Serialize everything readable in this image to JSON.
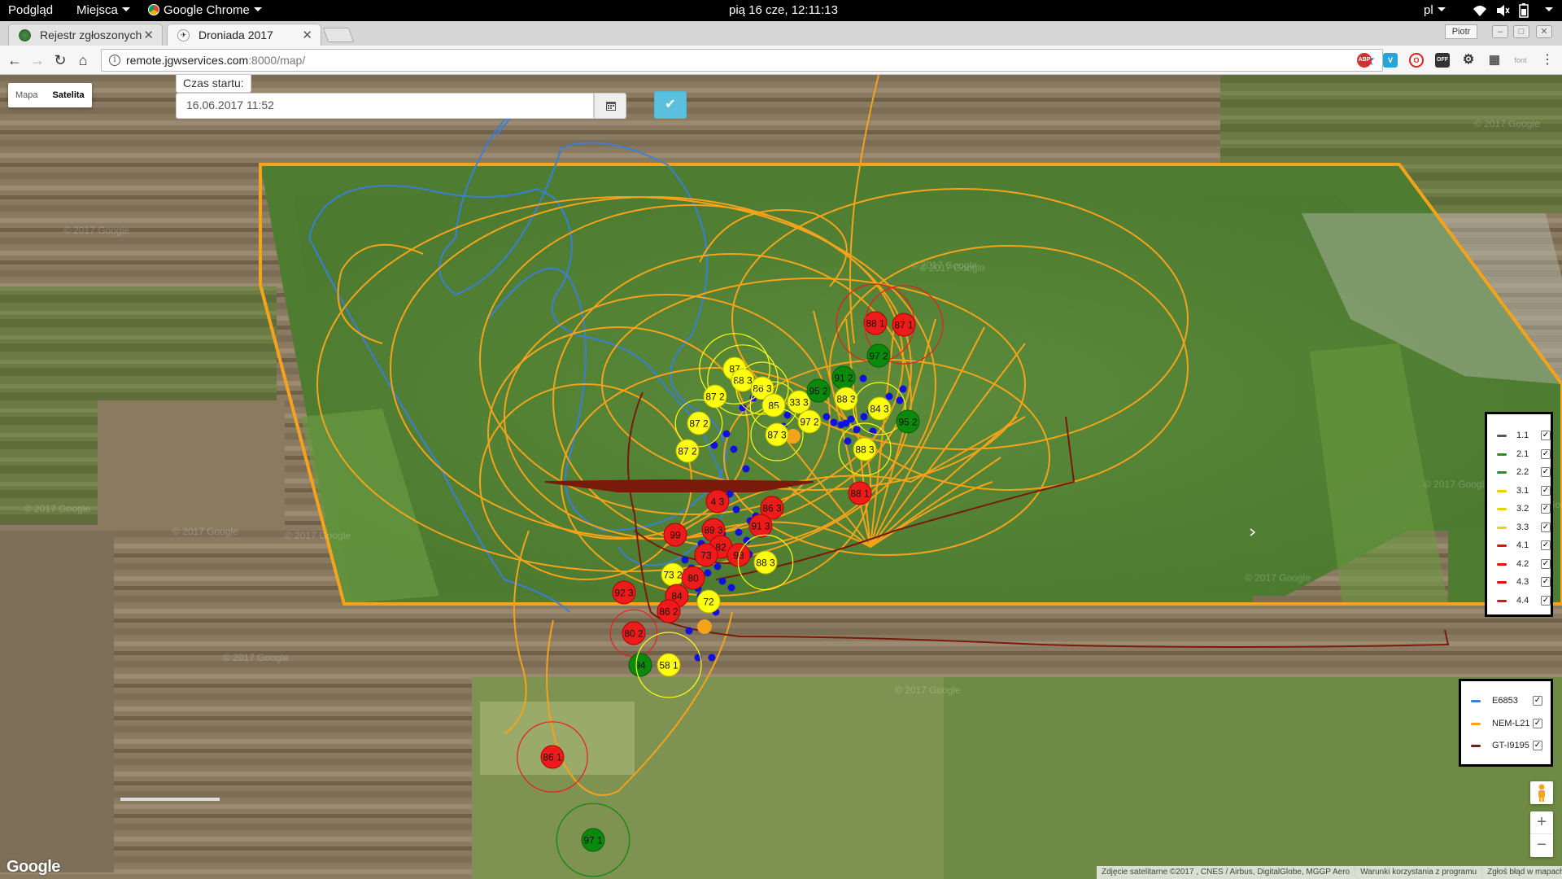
{
  "topbar": {
    "activities": "Podgląd",
    "places": "Miejsca",
    "app": "Google Chrome",
    "clock": "pią 16 cze, 12:11:13",
    "lang": "pl"
  },
  "tabs": [
    {
      "title": "Rejestr zgłoszonych",
      "active": false
    },
    {
      "title": "Droniada 2017",
      "active": true
    }
  ],
  "window": {
    "profile": "Piotr"
  },
  "toolbar": {
    "url_host": "remote.jgwservices.com",
    "url_rest": ":8000/map/"
  },
  "extensions": [
    "ABP",
    "V",
    "O",
    "OFF",
    "⚙",
    "▦",
    "font"
  ],
  "map": {
    "maptype": [
      "Mapa",
      "Satelita"
    ],
    "maptype_selected": "Satelita",
    "start_label": "Czas startu:",
    "start_value": "16.06.2017 11:52",
    "watermark": "© 2017 Google",
    "google": "Google",
    "attribution": [
      "Zdjęcie satelitarne ©2017 , CNES / Airbus, DigitalGlobe, MGGP Aero",
      "Warunki korzystania z programu",
      "Zgłoś błąd w mapach"
    ]
  },
  "legend_targets": [
    {
      "label": "1.1",
      "color": "#555555",
      "checked": true
    },
    {
      "label": "2.1",
      "color": "#1a9a1a",
      "checked": true
    },
    {
      "label": "2.2",
      "color": "#1a9a1a",
      "checked": true
    },
    {
      "label": "3.1",
      "color": "#e6d200",
      "checked": true
    },
    {
      "label": "3.2",
      "color": "#e6d200",
      "checked": true
    },
    {
      "label": "3.3",
      "color": "#e6d200",
      "checked": true
    },
    {
      "label": "4.1",
      "color": "#e01010",
      "checked": true
    },
    {
      "label": "4.2",
      "color": "#e01010",
      "checked": true
    },
    {
      "label": "4.3",
      "color": "#e01010",
      "checked": true
    },
    {
      "label": "4.4",
      "color": "#e01010",
      "checked": true
    }
  ],
  "legend_drones": [
    {
      "label": "E6853",
      "color": "#3a7fd5",
      "checked": true
    },
    {
      "label": "NEM-L21",
      "color": "#f5a31a",
      "checked": true
    },
    {
      "label": "GT-I9195",
      "color": "#7a1a0a",
      "checked": true
    }
  ],
  "markers": [
    {
      "label": "88 1",
      "color": "red"
    },
    {
      "label": "87 1",
      "color": "red"
    },
    {
      "label": "97 2",
      "color": "green"
    },
    {
      "label": "87",
      "color": "yellow"
    },
    {
      "label": "88 3",
      "color": "yellow"
    },
    {
      "label": "86 3",
      "color": "yellow"
    },
    {
      "label": "87 2",
      "color": "yellow"
    },
    {
      "label": "85",
      "color": "yellow"
    },
    {
      "label": "33 3",
      "color": "yellow"
    },
    {
      "label": "91 2",
      "color": "green"
    },
    {
      "label": "95 2",
      "color": "green"
    },
    {
      "label": "88 3",
      "color": "yellow"
    },
    {
      "label": "84 3",
      "color": "yellow"
    },
    {
      "label": "95 2",
      "color": "green"
    },
    {
      "label": "87 2",
      "color": "yellow"
    },
    {
      "label": "87 3",
      "color": "yellow"
    },
    {
      "label": "97 2",
      "color": "yellow"
    },
    {
      "label": "87 2",
      "color": "yellow"
    },
    {
      "label": "88 3",
      "color": "yellow"
    },
    {
      "label": "88 1",
      "color": "red"
    },
    {
      "label": "4 3",
      "color": "red"
    },
    {
      "label": "86 3",
      "color": "red"
    },
    {
      "label": "91 3",
      "color": "red"
    },
    {
      "label": "99",
      "color": "red"
    },
    {
      "label": "89 3",
      "color": "red"
    },
    {
      "label": "82",
      "color": "red"
    },
    {
      "label": "93",
      "color": "red"
    },
    {
      "label": "73",
      "color": "red"
    },
    {
      "label": "88 3",
      "color": "yellow"
    },
    {
      "label": "73 2",
      "color": "yellow"
    },
    {
      "label": "80",
      "color": "red"
    },
    {
      "label": "92 3",
      "color": "red"
    },
    {
      "label": "84",
      "color": "red"
    },
    {
      "label": "72",
      "color": "yellow"
    },
    {
      "label": "86 2",
      "color": "red"
    },
    {
      "label": "80 2",
      "color": "red"
    },
    {
      "label": "94",
      "color": "green"
    },
    {
      "label": "58 1",
      "color": "yellow"
    },
    {
      "label": "86 1",
      "color": "red"
    },
    {
      "label": "97 1",
      "color": "green"
    }
  ]
}
